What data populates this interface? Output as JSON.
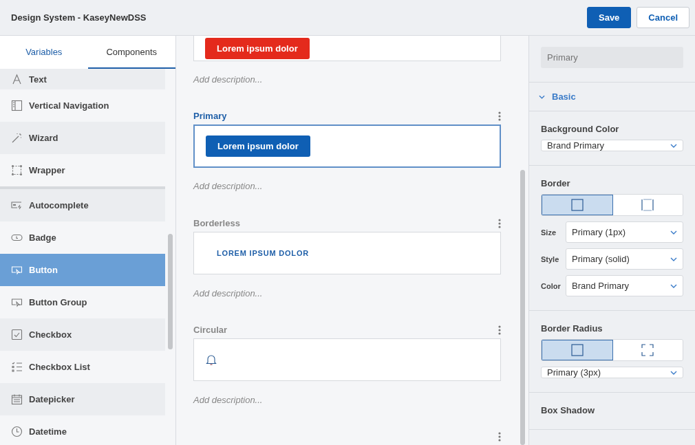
{
  "header": {
    "title": "Design System - KaseyNewDSS",
    "buttons": [
      {
        "label": "Save",
        "kind": "primary"
      },
      {
        "label": "Cancel",
        "kind": "secondary"
      }
    ]
  },
  "sidebar": {
    "tabs": [
      {
        "label": "Variables",
        "selected": false
      },
      {
        "label": "Components",
        "selected": true
      }
    ],
    "items": [
      {
        "label": "Text",
        "kind": "text",
        "selected": false
      },
      {
        "label": "Vertical Navigation",
        "kind": "vnav",
        "selected": false
      },
      {
        "label": "Wizard",
        "kind": "wand",
        "selected": false
      },
      {
        "label": "Wrapper",
        "kind": "wrapper",
        "selected": false
      },
      {
        "label": "Autocomplete",
        "kind": "autocomplete",
        "selected": false
      },
      {
        "label": "Badge",
        "kind": "badge",
        "selected": false
      },
      {
        "label": "Button",
        "kind": "button",
        "selected": true
      },
      {
        "label": "Button Group",
        "kind": "button",
        "selected": false
      },
      {
        "label": "Checkbox",
        "kind": "checkbox",
        "selected": false
      },
      {
        "label": "Checkbox List",
        "kind": "list",
        "selected": false
      },
      {
        "label": "Datepicker",
        "kind": "calendar",
        "selected": false
      },
      {
        "label": "Datetime",
        "kind": "clock",
        "selected": false
      }
    ]
  },
  "variants": [
    {
      "kind": "danger",
      "button": "Lorem ipsum dolor",
      "description": "Add description...",
      "selected": false
    },
    {
      "title": "Primary",
      "kind": "primary",
      "button": "Lorem ipsum dolor",
      "description": "Add description...",
      "selected": true
    },
    {
      "title": "Borderless",
      "kind": "borderless",
      "button": "LOREM IPSUM DOLOR",
      "description": "Add description...",
      "selected": false
    },
    {
      "title": "Circular",
      "kind": "circular",
      "description": "Add description...",
      "selected": false
    }
  ],
  "properties": {
    "name_placeholder": "Primary",
    "section": {
      "label": "Basic",
      "expanded": true
    },
    "background_color": {
      "label": "Background Color",
      "value": "Brand Primary"
    },
    "border": {
      "label": "Border",
      "options": [
        {
          "kind": "all",
          "selected": true
        },
        {
          "kind": "sides",
          "selected": false
        }
      ],
      "fields": [
        {
          "label": "Size",
          "value": "Primary (1px)"
        },
        {
          "label": "Style",
          "value": "Primary (solid)"
        },
        {
          "label": "Color",
          "value": "Brand Primary"
        }
      ]
    },
    "border_radius": {
      "label": "Border Radius",
      "options": [
        {
          "kind": "square",
          "selected": true
        },
        {
          "kind": "corners",
          "selected": false
        }
      ],
      "value": "Primary (3px)"
    },
    "box_shadow": {
      "label": "Box Shadow"
    }
  }
}
